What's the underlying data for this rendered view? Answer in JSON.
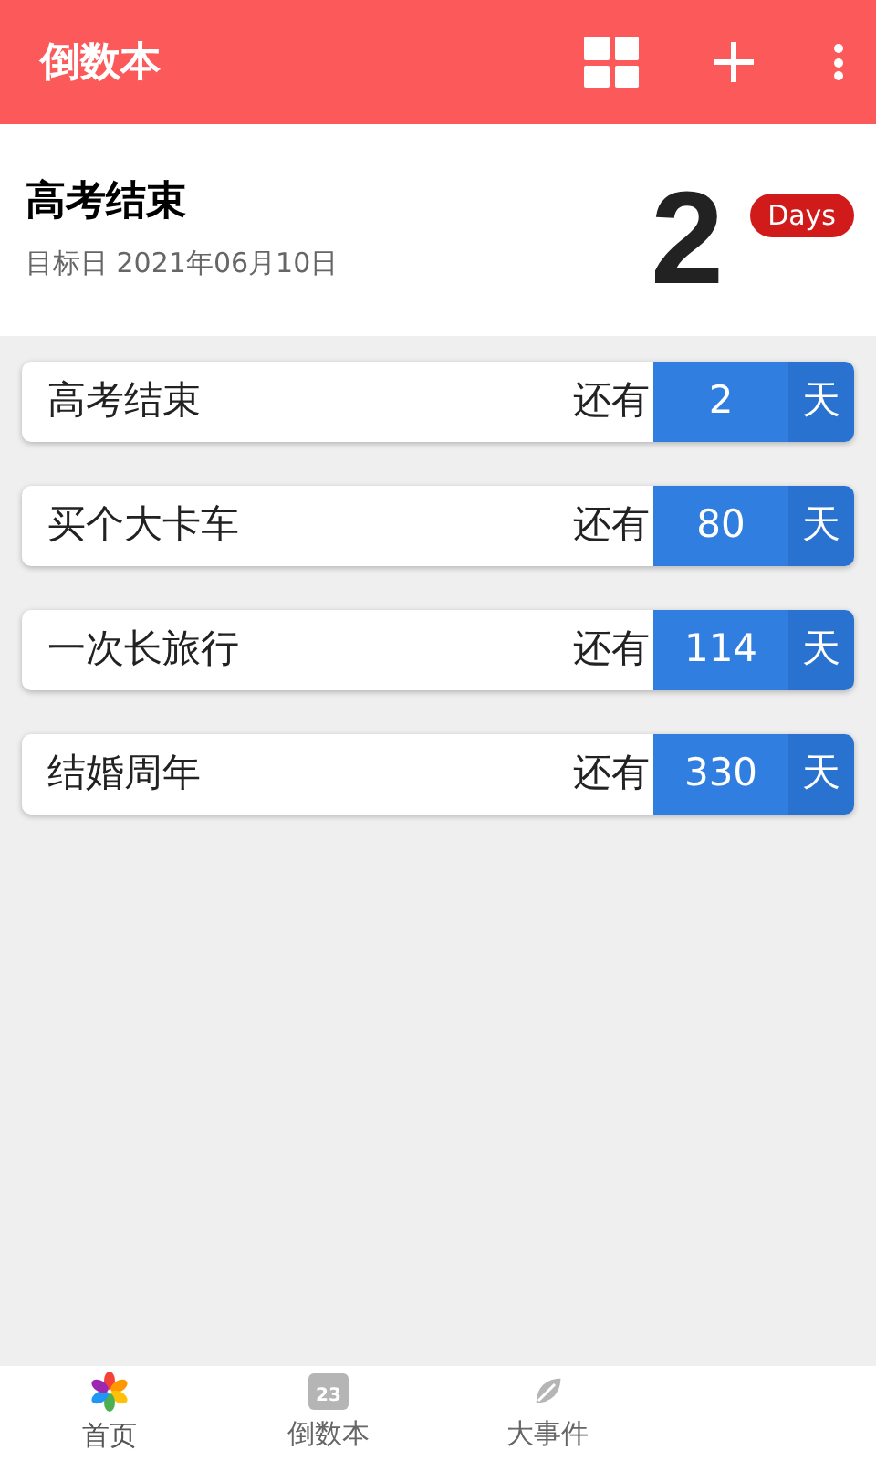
{
  "app_bar": {
    "title": "倒数本"
  },
  "featured": {
    "title": "高考结束",
    "target_date": "目标日 2021年06月10日",
    "days": "2",
    "unit": "Days"
  },
  "countdowns": [
    {
      "name": "高考结束",
      "prefix": "还有",
      "days": "2",
      "unit": "天"
    },
    {
      "name": "买个大卡车",
      "prefix": "还有",
      "days": "80",
      "unit": "天"
    },
    {
      "name": "一次长旅行",
      "prefix": "还有",
      "days": "114",
      "unit": "天"
    },
    {
      "name": "结婚周年",
      "prefix": "还有",
      "days": "330",
      "unit": "天"
    }
  ],
  "bottom_nav": [
    {
      "label": "首页",
      "kind": "flower",
      "selected": true
    },
    {
      "label": "倒数本",
      "kind": "calendar",
      "badge": "23",
      "selected": false
    },
    {
      "label": "大事件",
      "kind": "leaf",
      "selected": false
    }
  ]
}
